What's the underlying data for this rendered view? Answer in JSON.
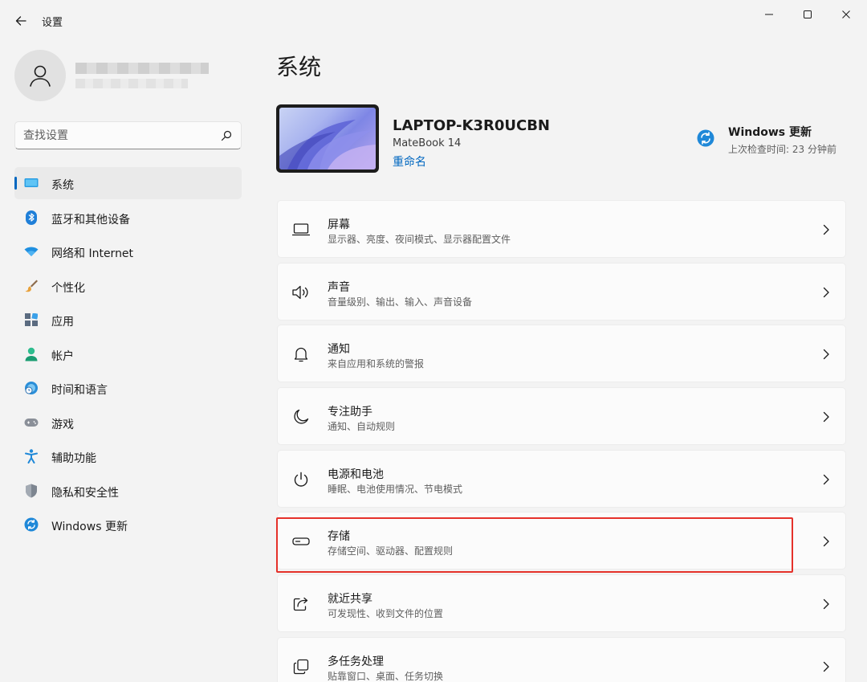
{
  "window": {
    "title": "设置"
  },
  "sidebar": {
    "search_placeholder": "查找设置",
    "items": [
      {
        "label": "系统",
        "icon": "monitor-icon",
        "active": true
      },
      {
        "label": "蓝牙和其他设备",
        "icon": "bluetooth-icon"
      },
      {
        "label": "网络和 Internet",
        "icon": "wifi-icon"
      },
      {
        "label": "个性化",
        "icon": "brush-icon"
      },
      {
        "label": "应用",
        "icon": "apps-icon"
      },
      {
        "label": "帐户",
        "icon": "person-icon"
      },
      {
        "label": "时间和语言",
        "icon": "globe-clock-icon"
      },
      {
        "label": "游戏",
        "icon": "gamepad-icon"
      },
      {
        "label": "辅助功能",
        "icon": "accessibility-icon"
      },
      {
        "label": "隐私和安全性",
        "icon": "shield-icon"
      },
      {
        "label": "Windows 更新",
        "icon": "update-icon"
      }
    ]
  },
  "main": {
    "title": "系统",
    "device": {
      "name": "LAPTOP-K3R0UCBN",
      "model": "MateBook 14",
      "rename": "重命名"
    },
    "windows_update": {
      "title": "Windows 更新",
      "subtitle": "上次检查时间: 23 分钟前"
    },
    "cards": [
      {
        "title": "屏幕",
        "subtitle": "显示器、亮度、夜间模式、显示器配置文件",
        "icon": "display-icon"
      },
      {
        "title": "声音",
        "subtitle": "音量级别、输出、输入、声音设备",
        "icon": "speaker-icon"
      },
      {
        "title": "通知",
        "subtitle": "来自应用和系统的警报",
        "icon": "bell-icon"
      },
      {
        "title": "专注助手",
        "subtitle": "通知、自动规则",
        "icon": "moon-icon"
      },
      {
        "title": "电源和电池",
        "subtitle": "睡眠、电池使用情况、节电模式",
        "icon": "power-icon"
      },
      {
        "title": "存储",
        "subtitle": "存储空间、驱动器、配置规则",
        "icon": "storage-icon"
      },
      {
        "title": "就近共享",
        "subtitle": "可发现性、收到文件的位置",
        "icon": "share-icon"
      },
      {
        "title": "多任务处理",
        "subtitle": "贴靠窗口、桌面、任务切换",
        "icon": "multitask-icon"
      }
    ]
  },
  "colors": {
    "accent": "#0067c0",
    "highlight": "#e5312a"
  }
}
